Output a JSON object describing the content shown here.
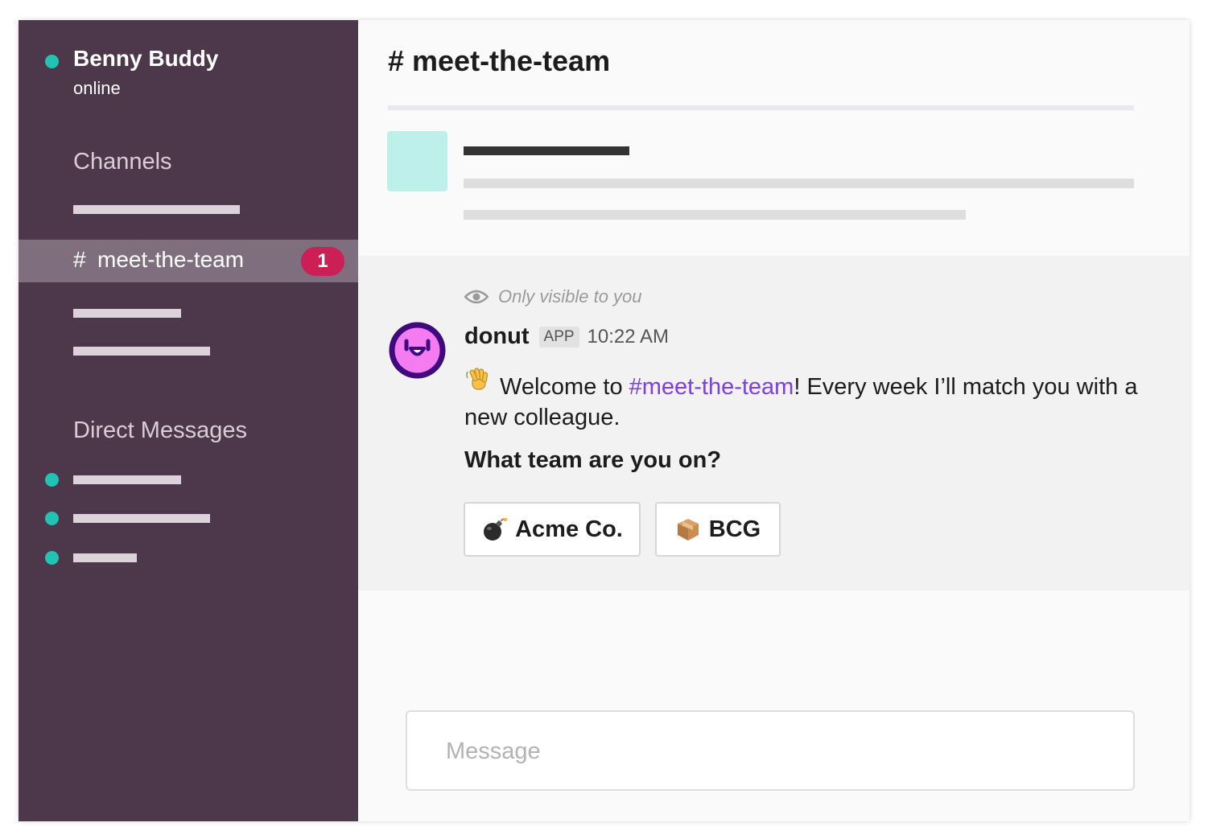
{
  "user": {
    "name": "Benny Buddy",
    "status": "online"
  },
  "sidebar": {
    "channels_title": "Channels",
    "active_channel": {
      "hash": "#",
      "name": "meet-the-team",
      "unread": "1"
    },
    "dm_title": "Direct Messages"
  },
  "channel": {
    "title": "# meet-the-team"
  },
  "message": {
    "visibility": "Only visible to you",
    "author": "donut",
    "tag": "APP",
    "time": "10:22 AM",
    "text_before": "Welcome to ",
    "channel_link": "#meet-the-team",
    "text_after": "! Every week I’ll match you with a new colleague.",
    "question": "What team are you on?",
    "actions": [
      {
        "label": "Acme Co.",
        "icon": "bomb-icon"
      },
      {
        "label": "BCG",
        "icon": "package-icon"
      }
    ]
  },
  "composer": {
    "placeholder": "Message"
  },
  "colors": {
    "sidebar": "#4d384b",
    "active_item": "#7f6f7e",
    "presence": "#21c4b2",
    "badge": "#cc1f56",
    "link": "#7b3fe4",
    "bot_avatar": "#f47cf0"
  }
}
